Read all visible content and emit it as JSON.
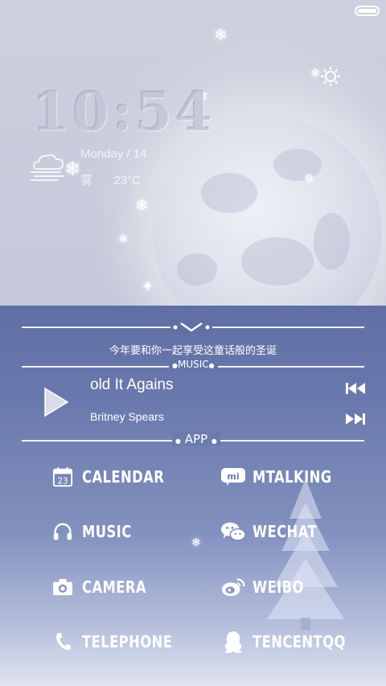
{
  "lockscreen": {
    "time": "10:54",
    "date": "Monday / 14",
    "weather": {
      "condition": "雾",
      "temperature": "23°C",
      "icon": "fog-cloud-icon"
    }
  },
  "status_bar": {
    "battery_icon": "battery-full-icon"
  },
  "tagline": "今年要和你一起享受这童话般的圣诞",
  "music_section_label": "MUSIC",
  "music": {
    "title": "old It Agains",
    "artist": "Britney Spears",
    "controls": [
      "play-icon",
      "previous-icon",
      "next-icon"
    ]
  },
  "app_section_label": "APP",
  "apps": [
    {
      "label": "CALENDAR",
      "icon": "calendar-icon",
      "badge": "23"
    },
    {
      "label": "MTALKING",
      "icon": "mtalking-icon",
      "badge": "mi"
    },
    {
      "label": "MUSIC",
      "icon": "headphones-icon"
    },
    {
      "label": "WECHAT",
      "icon": "wechat-icon"
    },
    {
      "label": "CAMERA",
      "icon": "camera-icon"
    },
    {
      "label": "WEIBO",
      "icon": "weibo-icon"
    },
    {
      "label": "TELEPHONE",
      "icon": "phone-icon"
    },
    {
      "label": "TENCENTQQ",
      "icon": "qq-penguin-icon"
    }
  ],
  "colors": {
    "panel_top": "#5f6fa4",
    "panel_bottom": "#dfe4f0",
    "text": "#ffffff"
  }
}
